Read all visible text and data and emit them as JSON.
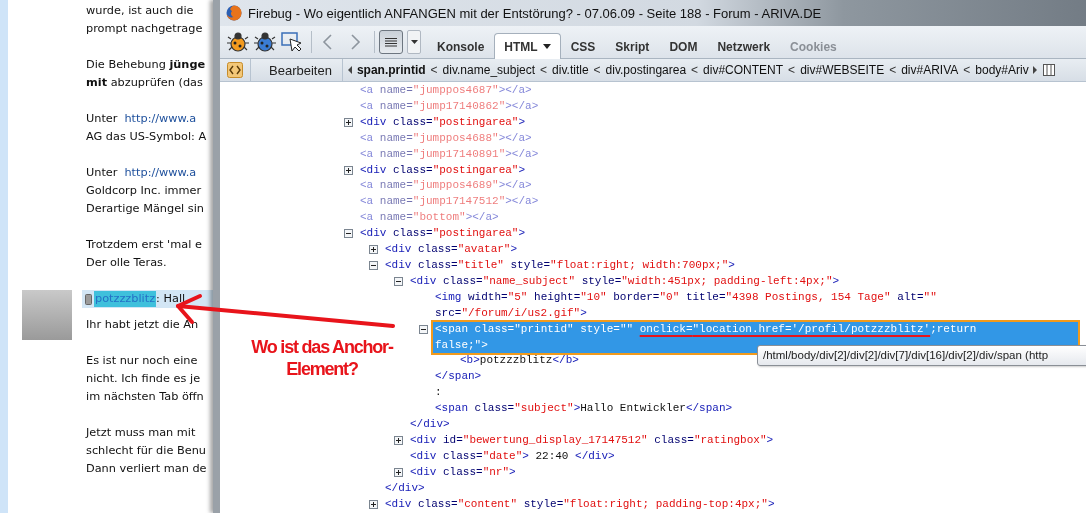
{
  "page": {
    "paragraphs": [
      [
        {
          "text": "wurde, ist auch die"
        },
        {
          "text": "prompt nachgetrage"
        }
      ],
      [
        {
          "text": "Die Behebung **jünge**"
        },
        {
          "text": "**mit** abzuprüfen (das"
        }
      ],
      [
        {
          "text": "Unter",
          "link": "http://www.a"
        },
        {
          "text": "AG das US-Symbol: A"
        }
      ],
      [
        {
          "text": "Unter",
          "link": "http://www.a"
        },
        {
          "text": "Goldcorp Inc. immer"
        },
        {
          "text": "Derartige Mängel sin"
        }
      ],
      [
        {
          "text": "Trotzdem erst 'mal e"
        },
        {
          "text": "Der olle Teras."
        }
      ]
    ],
    "post": {
      "author": "potzzzblitz",
      "author_highlighted": true,
      "subject": ": Hall",
      "paragraphs": [
        [
          {
            "text": "Ihr habt jetzt die An"
          }
        ],
        [
          {
            "text": "Es ist nur noch eine"
          },
          {
            "text": "nicht. Ich finde es je"
          },
          {
            "text": "im nächsten Tab öffn"
          }
        ],
        [
          {
            "text": "Jetzt muss man mit"
          },
          {
            "text": "schlecht für die Benu"
          },
          {
            "text": "Dann verliert man de"
          }
        ]
      ]
    }
  },
  "window": {
    "title": "Firebug - Wo eigentlich ANFANGEN mit der Entstörung? - 07.06.09 - Seite 188 - Forum - ARIVA.DE"
  },
  "toolbar": {
    "panel_menu": {
      "pressed": true
    },
    "tabs": [
      {
        "label": "Konsole",
        "selected": false,
        "disabled": false,
        "dropdown": false
      },
      {
        "label": "HTML",
        "selected": true,
        "disabled": false,
        "dropdown": true
      },
      {
        "label": "CSS",
        "selected": false,
        "disabled": false,
        "dropdown": false
      },
      {
        "label": "Skript",
        "selected": false,
        "disabled": false,
        "dropdown": false
      },
      {
        "label": "DOM",
        "selected": false,
        "disabled": false,
        "dropdown": false
      },
      {
        "label": "Netzwerk",
        "selected": false,
        "disabled": false,
        "dropdown": false
      },
      {
        "label": "Cookies",
        "selected": false,
        "disabled": true,
        "dropdown": false
      }
    ]
  },
  "breadcrumb": {
    "edit_button": "Bearbeiten",
    "separator": "<",
    "items": [
      {
        "label": "span.printid",
        "selected": true
      },
      {
        "label": "div.name_subject",
        "selected": false
      },
      {
        "label": "div.title",
        "selected": false
      },
      {
        "label": "div.postingarea",
        "selected": false
      },
      {
        "label": "div#CONTENT",
        "selected": false
      },
      {
        "label": "div#WEBSEITE",
        "selected": false
      },
      {
        "label": "div#ARIVA",
        "selected": false
      },
      {
        "label": "body#Ariv",
        "selected": false
      }
    ]
  },
  "html_tree": [
    {
      "kind": "plain",
      "selected": false,
      "faded": true,
      "parts": [
        {
          "kind": "tag",
          "text": "<a"
        },
        {
          "kind": "attr",
          "text": " name="
        },
        {
          "kind": "value",
          "text": "\"jumppos4687\""
        },
        {
          "kind": "tag",
          "text": "></a>"
        }
      ]
    },
    {
      "kind": "plain",
      "selected": false,
      "faded": true,
      "parts": [
        {
          "kind": "tag",
          "text": "<a"
        },
        {
          "kind": "attr",
          "text": " name="
        },
        {
          "kind": "value",
          "text": "\"jump17140862\""
        },
        {
          "kind": "tag",
          "text": "></a>"
        }
      ]
    },
    {
      "kind": "toggle",
      "expanded": false,
      "selected": false,
      "faded": false,
      "parts": [
        {
          "kind": "tag",
          "text": "<div"
        },
        {
          "kind": "attr",
          "text": " class="
        },
        {
          "kind": "value",
          "text": "\"postingarea\""
        },
        {
          "kind": "tag",
          "text": ">"
        }
      ]
    },
    {
      "kind": "plain",
      "selected": false,
      "faded": true,
      "parts": [
        {
          "kind": "tag",
          "text": "<a"
        },
        {
          "kind": "attr",
          "text": " name="
        },
        {
          "kind": "value",
          "text": "\"jumppos4688\""
        },
        {
          "kind": "tag",
          "text": "></a>"
        }
      ]
    },
    {
      "kind": "plain",
      "selected": false,
      "faded": true,
      "parts": [
        {
          "kind": "tag",
          "text": "<a"
        },
        {
          "kind": "attr",
          "text": " name="
        },
        {
          "kind": "value",
          "text": "\"jump17140891\""
        },
        {
          "kind": "tag",
          "text": "></a>"
        }
      ]
    },
    {
      "kind": "toggle",
      "expanded": false,
      "selected": false,
      "faded": false,
      "parts": [
        {
          "kind": "tag",
          "text": "<div"
        },
        {
          "kind": "attr",
          "text": " class="
        },
        {
          "kind": "value",
          "text": "\"postingarea\""
        },
        {
          "kind": "tag",
          "text": ">"
        }
      ]
    },
    {
      "kind": "plain",
      "selected": false,
      "faded": true,
      "parts": [
        {
          "kind": "tag",
          "text": "<a"
        },
        {
          "kind": "attr",
          "text": " name="
        },
        {
          "kind": "value",
          "text": "\"jumppos4689\""
        },
        {
          "kind": "tag",
          "text": "></a>"
        }
      ]
    },
    {
      "kind": "plain",
      "selected": false,
      "faded": true,
      "parts": [
        {
          "kind": "tag",
          "text": "<a"
        },
        {
          "kind": "attr",
          "text": " name="
        },
        {
          "kind": "value",
          "text": "\"jump17147512\""
        },
        {
          "kind": "tag",
          "text": "></a>"
        }
      ]
    },
    {
      "kind": "plain",
      "selected": false,
      "faded": true,
      "parts": [
        {
          "kind": "tag",
          "text": "<a"
        },
        {
          "kind": "attr",
          "text": " name="
        },
        {
          "kind": "value",
          "text": "\"bottom\""
        },
        {
          "kind": "tag",
          "text": "></a>"
        }
      ]
    },
    {
      "kind": "toggle",
      "expanded": true,
      "selected": false,
      "faded": false,
      "parts": [
        {
          "kind": "tag",
          "text": "<div"
        },
        {
          "kind": "attr",
          "text": " class="
        },
        {
          "kind": "value",
          "text": "\"postingarea\""
        },
        {
          "kind": "tag",
          "text": ">"
        }
      ],
      "children": [
        {
          "kind": "toggle",
          "expanded": false,
          "selected": false,
          "faded": false,
          "parts": [
            {
              "kind": "tag",
              "text": "<div"
            },
            {
              "kind": "attr",
              "text": " class="
            },
            {
              "kind": "value",
              "text": "\"avatar\""
            },
            {
              "kind": "tag",
              "text": ">"
            }
          ]
        },
        {
          "kind": "toggle",
          "expanded": true,
          "selected": false,
          "faded": false,
          "parts": [
            {
              "kind": "tag",
              "text": "<div"
            },
            {
              "kind": "attr",
              "text": " class="
            },
            {
              "kind": "value",
              "text": "\"title\""
            },
            {
              "kind": "attr",
              "text": " style="
            },
            {
              "kind": "value",
              "text": "\"float:right; width:700px;\""
            },
            {
              "kind": "tag",
              "text": ">"
            }
          ],
          "children": [
            {
              "kind": "toggle",
              "expanded": true,
              "selected": false,
              "faded": false,
              "parts": [
                {
                  "kind": "tag",
                  "text": "<div"
                },
                {
                  "kind": "attr",
                  "text": " class="
                },
                {
                  "kind": "value",
                  "text": "\"name_subject\""
                },
                {
                  "kind": "attr",
                  "text": " style="
                },
                {
                  "kind": "value",
                  "text": "\"width:451px; padding-left:4px;\""
                },
                {
                  "kind": "tag",
                  "text": ">"
                }
              ],
              "children": [
                {
                  "kind": "plain",
                  "selected": false,
                  "faded": false,
                  "parts": [
                    {
                      "kind": "tag",
                      "text": "<img"
                    },
                    {
                      "kind": "attr",
                      "text": " width="
                    },
                    {
                      "kind": "value",
                      "text": "\"5\""
                    },
                    {
                      "kind": "attr",
                      "text": " height="
                    },
                    {
                      "kind": "value",
                      "text": "\"10\""
                    },
                    {
                      "kind": "attr",
                      "text": " border="
                    },
                    {
                      "kind": "value",
                      "text": "\"0\""
                    },
                    {
                      "kind": "attr",
                      "text": " title="
                    },
                    {
                      "kind": "value",
                      "text": "\"4398 Postings, 154 Tage\""
                    },
                    {
                      "kind": "attr",
                      "text": " alt="
                    },
                    {
                      "kind": "value",
                      "text": "\"\""
                    },
                    {
                      "kind": "attr",
                      "text": " src="
                    },
                    {
                      "kind": "value",
                      "text": "\"/forum/i/us2.gif\""
                    },
                    {
                      "kind": "tag",
                      "text": ">"
                    }
                  ]
                },
                {
                  "kind": "toggle",
                  "expanded": true,
                  "selected": true,
                  "faded": false,
                  "parts": [
                    {
                      "kind": "tag",
                      "text": "<span",
                      "marked": false
                    },
                    {
                      "kind": "attr",
                      "text": " class=",
                      "marked": false
                    },
                    {
                      "kind": "value",
                      "text": "\"printid\"",
                      "marked": false
                    },
                    {
                      "kind": "attr",
                      "text": " style=",
                      "marked": false
                    },
                    {
                      "kind": "value",
                      "text": "\"\" ",
                      "marked": false
                    },
                    {
                      "kind": "attr",
                      "text": "onclick=",
                      "marked": true
                    },
                    {
                      "kind": "value",
                      "text": "\"location.href='/profil/potzzzblitz'",
                      "marked": true
                    },
                    {
                      "kind": "value",
                      "text": ";return false;\"",
                      "marked": false
                    },
                    {
                      "kind": "tag",
                      "text": ">",
                      "marked": false
                    }
                  ],
                  "children": [
                    {
                      "kind": "plain",
                      "selected": false,
                      "faded": false,
                      "parts": [
                        {
                          "kind": "tag",
                          "text": "<b>"
                        },
                        {
                          "kind": "text",
                          "text": "potzzzblitz"
                        },
                        {
                          "kind": "tag",
                          "text": "</b>"
                        }
                      ]
                    }
                  ]
                },
                {
                  "kind": "plain",
                  "selected": false,
                  "faded": false,
                  "parts": [
                    {
                      "kind": "tag",
                      "text": "</span>"
                    }
                  ]
                },
                {
                  "kind": "plain",
                  "selected": false,
                  "faded": false,
                  "parts": [
                    {
                      "kind": "text",
                      "text": ":"
                    }
                  ]
                },
                {
                  "kind": "plain",
                  "selected": false,
                  "faded": false,
                  "parts": [
                    {
                      "kind": "tag",
                      "text": "<span"
                    },
                    {
                      "kind": "attr",
                      "text": " class="
                    },
                    {
                      "kind": "value",
                      "text": "\"subject\""
                    },
                    {
                      "kind": "tag",
                      "text": ">"
                    },
                    {
                      "kind": "text",
                      "text": "Hallo Entwickler"
                    },
                    {
                      "kind": "tag",
                      "text": "</span>"
                    }
                  ]
                }
              ]
            },
            {
              "kind": "plain",
              "selected": false,
              "faded": false,
              "parts": [
                {
                  "kind": "tag",
                  "text": "</div>"
                }
              ]
            },
            {
              "kind": "toggle",
              "expanded": false,
              "selected": false,
              "faded": false,
              "parts": [
                {
                  "kind": "tag",
                  "text": "<div"
                },
                {
                  "kind": "attr",
                  "text": " id="
                },
                {
                  "kind": "value",
                  "text": "\"bewertung_display_17147512\""
                },
                {
                  "kind": "attr",
                  "text": " class="
                },
                {
                  "kind": "value",
                  "text": "\"ratingbox\""
                },
                {
                  "kind": "tag",
                  "text": ">"
                }
              ]
            },
            {
              "kind": "plain",
              "selected": false,
              "faded": false,
              "parts": [
                {
                  "kind": "tag",
                  "text": "<div"
                },
                {
                  "kind": "attr",
                  "text": " class="
                },
                {
                  "kind": "value",
                  "text": "\"date\""
                },
                {
                  "kind": "tag",
                  "text": ">"
                },
                {
                  "kind": "text",
                  "text": " 22:40 "
                },
                {
                  "kind": "tag",
                  "text": "</div>"
                }
              ]
            },
            {
              "kind": "toggle",
              "expanded": false,
              "selected": false,
              "faded": false,
              "parts": [
                {
                  "kind": "tag",
                  "text": "<div"
                },
                {
                  "kind": "attr",
                  "text": " class="
                },
                {
                  "kind": "value",
                  "text": "\"nr\""
                },
                {
                  "kind": "tag",
                  "text": ">"
                }
              ]
            }
          ]
        },
        {
          "kind": "plain",
          "selected": false,
          "faded": false,
          "parts": [
            {
              "kind": "tag",
              "text": "</div>"
            }
          ]
        },
        {
          "kind": "toggle",
          "expanded": false,
          "selected": false,
          "faded": false,
          "parts": [
            {
              "kind": "tag",
              "text": "<div"
            },
            {
              "kind": "attr",
              "text": " class="
            },
            {
              "kind": "value",
              "text": "\"content\""
            },
            {
              "kind": "attr",
              "text": " style="
            },
            {
              "kind": "value",
              "text": "\"float:right; padding-top:4px;\""
            },
            {
              "kind": "tag",
              "text": ">"
            }
          ]
        }
      ]
    }
  ],
  "tooltip": "/html/body/div[2]/div[2]/div[7]/div[16]/div[2]/div/span (http",
  "annotation": {
    "lines": [
      "Wo ist das Anchor-",
      "Element?"
    ]
  }
}
